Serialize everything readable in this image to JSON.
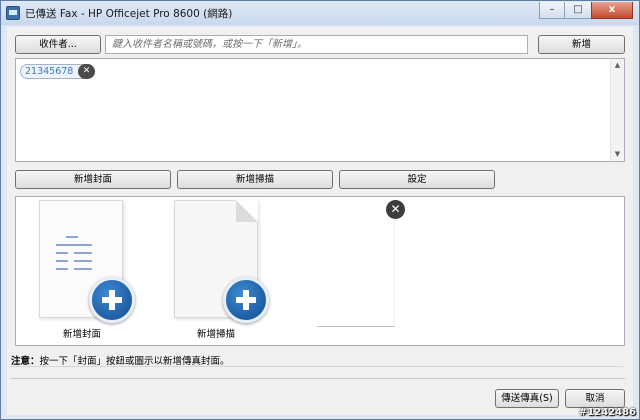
{
  "window": {
    "title": "已傳送 Fax - HP Officejet Pro 8600 (網路)",
    "controls": {
      "minimize": "–",
      "maximize": "□",
      "close": "x"
    }
  },
  "recipients": {
    "button_label": "收件者...",
    "placeholder": "鍵入收件者名稱或號碼，或按一下「新增」。",
    "add_button_label": "新增",
    "list": [
      {
        "number": "21345678"
      }
    ]
  },
  "toolbar": {
    "add_cover_label": "新增封面",
    "add_scan_label": "新增掃描",
    "settings_label": "設定"
  },
  "documents": {
    "cover_label": "新增封面",
    "scan_label": "新增掃描"
  },
  "note": {
    "prefix": "注意：",
    "text": "按一下「封面」按鈕或圖示以新增傳真封面。"
  },
  "footer": {
    "send_label": "傳送傳真(S)",
    "cancel_label": "取消"
  },
  "watermark": "#1242486"
}
